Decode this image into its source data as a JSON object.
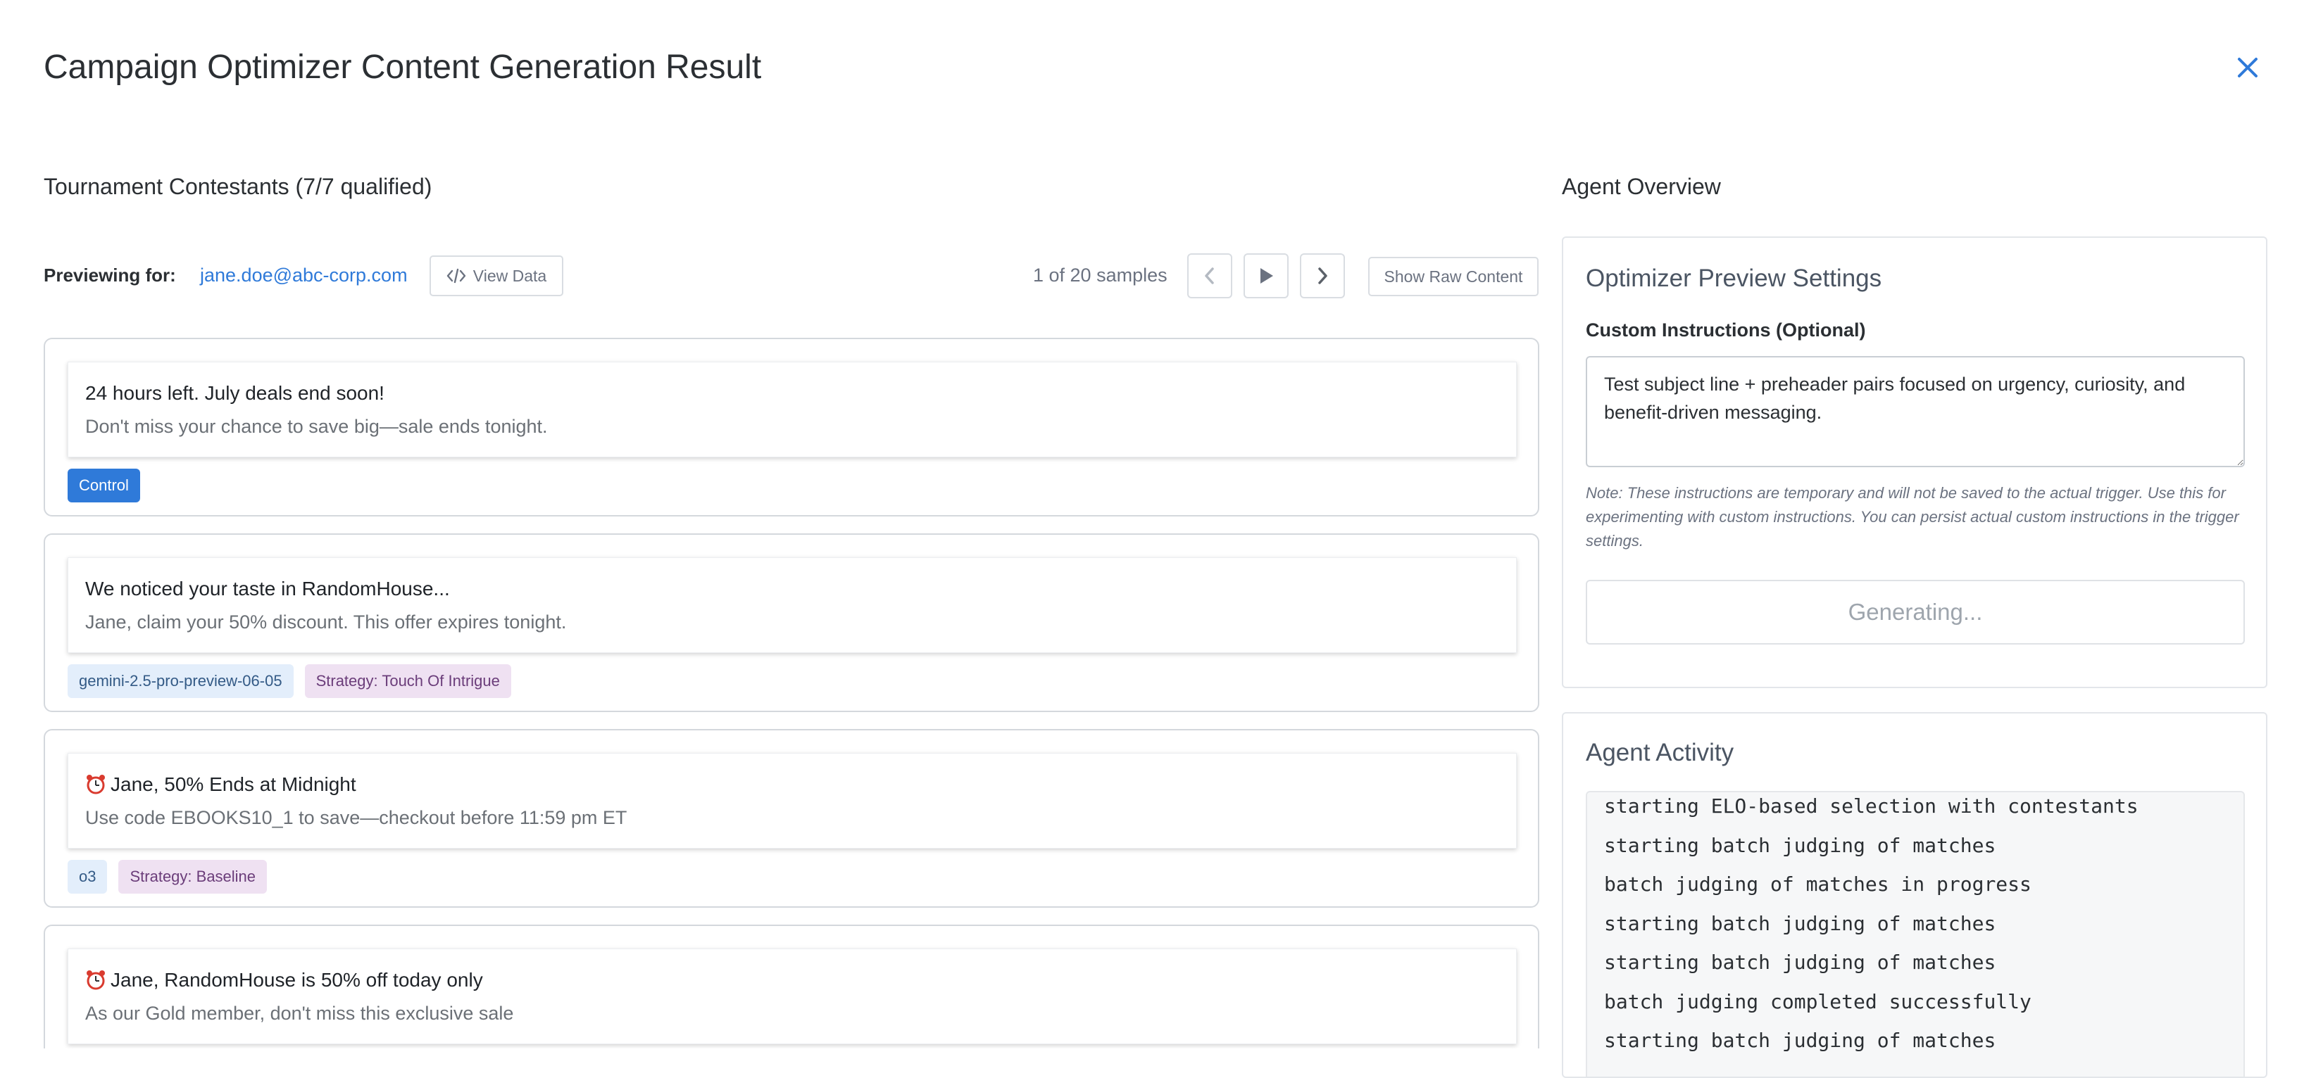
{
  "header": {
    "title": "Campaign Optimizer Content Generation Result",
    "close_icon": "close-icon"
  },
  "contestants_section": {
    "title": "Tournament Contestants (7/7 qualified)"
  },
  "preview": {
    "label": "Previewing for:",
    "email": "jane.doe@abc-corp.com",
    "view_data_label": "View Data",
    "samples_label": "1 of 20 samples",
    "raw_content_label": "Show Raw Content"
  },
  "contestants": [
    {
      "subject": "24 hours left. July deals end soon!",
      "preheader": "Don't miss your chance to save big—sale ends tonight.",
      "alarm": false,
      "tags": [
        {
          "text": "Control",
          "kind": "control"
        }
      ]
    },
    {
      "subject": "We noticed your taste in RandomHouse...",
      "preheader": "Jane, claim your 50% discount. This offer expires tonight.",
      "alarm": false,
      "tags": [
        {
          "text": "gemini-2.5-pro-preview-06-05",
          "kind": "model"
        },
        {
          "text": "Strategy: Touch Of Intrigue",
          "kind": "strategy"
        }
      ]
    },
    {
      "subject": "Jane, 50% Ends at Midnight",
      "preheader": "Use code EBOOKS10_1 to save—checkout before 11:59 pm ET",
      "alarm": true,
      "tags": [
        {
          "text": "o3",
          "kind": "model"
        },
        {
          "text": "Strategy: Baseline",
          "kind": "strategy"
        }
      ]
    },
    {
      "subject": "Jane, RandomHouse is 50% off today only",
      "preheader": "As our Gold member, don't miss this exclusive sale",
      "alarm": true,
      "tags": []
    }
  ],
  "agent_overview": {
    "title": "Agent Overview",
    "settings": {
      "title": "Optimizer Preview Settings",
      "instructions_label": "Custom Instructions (Optional)",
      "instructions_value": "Test subject line + preheader pairs focused on urgency, curiosity, and benefit-driven messaging.",
      "note": "Note: These instructions are temporary and will not be saved to the actual trigger. Use this for experimenting with custom instructions. You can persist actual custom instructions in the trigger settings.",
      "generating_label": "Generating..."
    },
    "activity": {
      "title": "Agent Activity",
      "lines": [
        "starting ELO-based selection with contestants",
        "starting batch judging of matches",
        "batch judging of matches in progress",
        "starting batch judging of matches",
        "starting batch judging of matches",
        "batch judging completed successfully",
        "starting batch judging of matches"
      ]
    }
  },
  "colors": {
    "accent": "#2f7ad9",
    "model_tag_bg": "#e3eefb",
    "strategy_tag_bg": "#efe1f2"
  }
}
